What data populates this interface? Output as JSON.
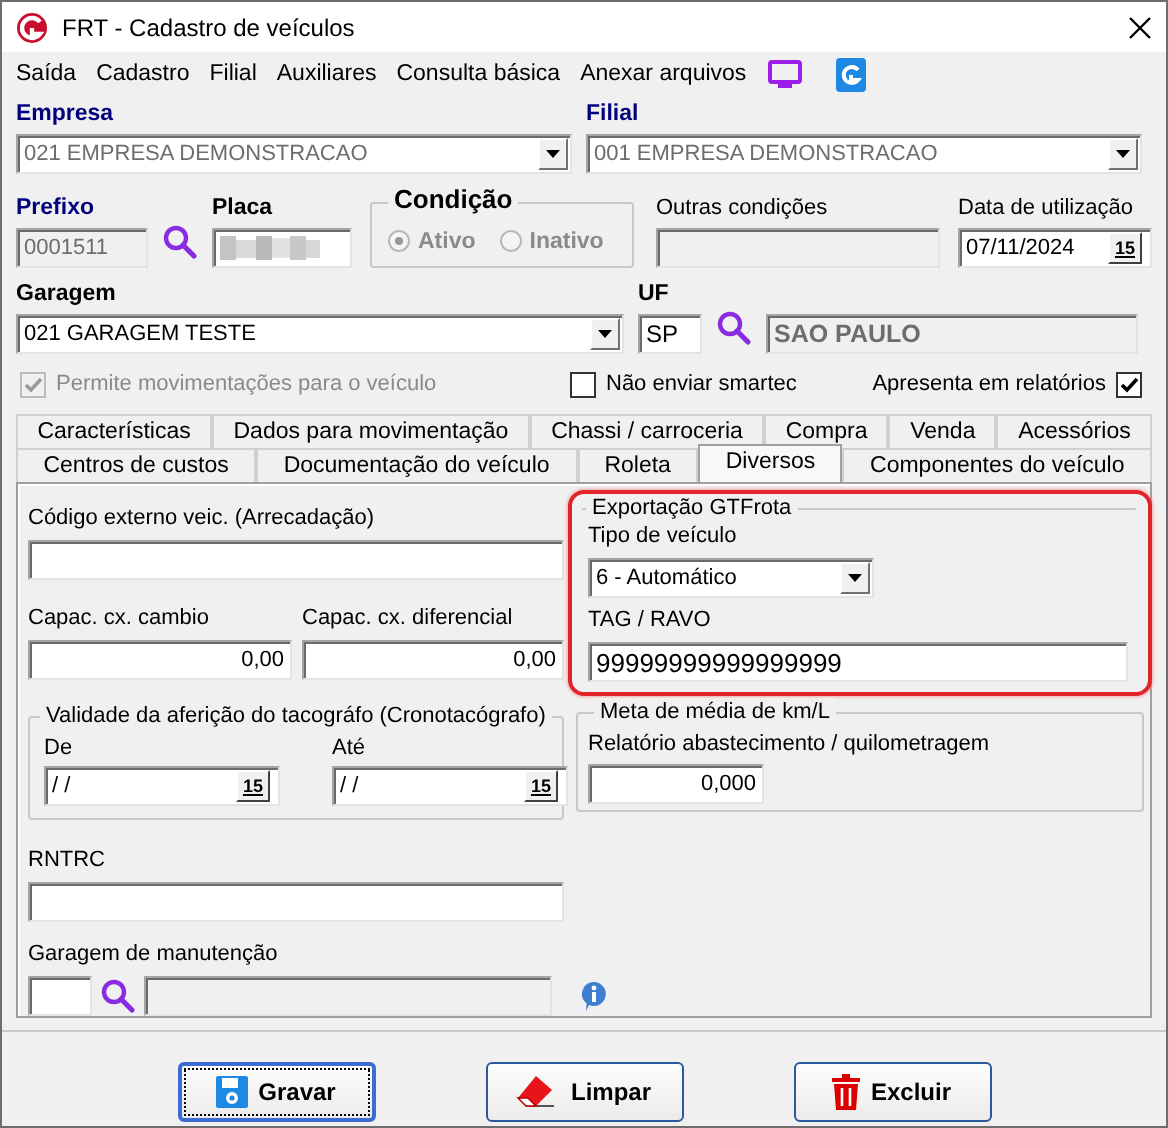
{
  "window": {
    "title": "FRT - Cadastro de veículos"
  },
  "menu": [
    {
      "label": "Saída"
    },
    {
      "label": "Cadastro"
    },
    {
      "label": "Filial"
    },
    {
      "label": "Auxiliares"
    },
    {
      "label": "Consulta básica"
    },
    {
      "label": "Anexar arquivos"
    }
  ],
  "empresa": {
    "label": "Empresa",
    "value": "021 EMPRESA DEMONSTRACAO",
    "required": true,
    "disabled": true
  },
  "filial": {
    "label": "Filial",
    "value": "001 EMPRESA DEMONSTRACAO",
    "required": true,
    "disabled": true
  },
  "prefixo": {
    "label": "Prefixo",
    "value": "0001511",
    "required": true,
    "disabled": true
  },
  "placa": {
    "label": "Placa",
    "required": false
  },
  "condicao": {
    "label": "Condição",
    "disabled": true,
    "options": [
      {
        "label": "Ativo",
        "selected": true
      },
      {
        "label": "Inativo",
        "selected": false
      }
    ]
  },
  "outras_condicoes": {
    "label": "Outras condições"
  },
  "data_utilizacao": {
    "label": "Data de utilização",
    "value": "07/11/2024",
    "button": "15"
  },
  "garagem": {
    "label": "Garagem",
    "value": "021 GARAGEM TESTE",
    "required": false
  },
  "uf": {
    "label": "UF",
    "value": "SP",
    "name": "SAO PAULO",
    "required": false
  },
  "options": [
    {
      "label": "Permite movimentações para o veículo",
      "checked": true,
      "disabled": true,
      "kind": "box-left"
    },
    {
      "label": "Não enviar smartec",
      "checked": false,
      "disabled": false,
      "kind": "box-left"
    },
    {
      "label": "Apresenta em relatórios",
      "checked": true,
      "disabled": false,
      "kind": "box-right"
    }
  ],
  "tab_rows": [
    {
      "tabs": [
        {
          "label": "Características",
          "selected": false
        },
        {
          "label": "Dados para movimentação",
          "selected": false
        },
        {
          "label": "Chassi / carroceria",
          "selected": false
        },
        {
          "label": "Compra",
          "selected": false
        },
        {
          "label": "Venda",
          "selected": false
        },
        {
          "label": "Acessórios",
          "selected": false
        }
      ]
    },
    {
      "tabs": [
        {
          "label": "Centros de custos",
          "selected": false
        },
        {
          "label": "Documentação do veículo",
          "selected": false
        },
        {
          "label": "Roleta",
          "selected": false
        },
        {
          "label": "Diversos",
          "selected": true
        },
        {
          "label": "Componentes do veículo",
          "selected": false
        }
      ]
    }
  ],
  "diversos": {
    "codigo_externo": {
      "label": "Código externo veic. (Arrecadação)"
    },
    "capac_cambio": {
      "label": "Capac. cx. cambio",
      "value": "0,00"
    },
    "capac_diferencial": {
      "label": "Capac. cx. diferencial",
      "value": "0,00"
    },
    "validade": {
      "title": "Validade da aferição do tacográfo (Cronotacógrafo)",
      "de": {
        "label": "De",
        "value": " /  /",
        "button": "15"
      },
      "ate": {
        "label": "Até",
        "value": " /  /",
        "button": "15"
      }
    },
    "rntrc": {
      "label": "RNTRC"
    },
    "garagem_manutencao": {
      "label": "Garagem de manutenção"
    },
    "exportacao": {
      "title": "Exportação GTFrota",
      "highlighted": true,
      "tipo_label": "Tipo de veículo",
      "tipo_value": "6 - Automático",
      "tag_label": "TAG / RAVO",
      "tag_value": "99999999999999999"
    },
    "meta": {
      "title": "Meta de média de km/L",
      "label": "Relatório abastecimento / quilometragem",
      "value": "0,000"
    }
  },
  "buttons": [
    {
      "label": "Gravar",
      "kind": "save",
      "focused": true
    },
    {
      "label": "Limpar",
      "kind": "clear",
      "focused": false
    },
    {
      "label": "Excluir",
      "kind": "delete",
      "focused": false
    }
  ]
}
